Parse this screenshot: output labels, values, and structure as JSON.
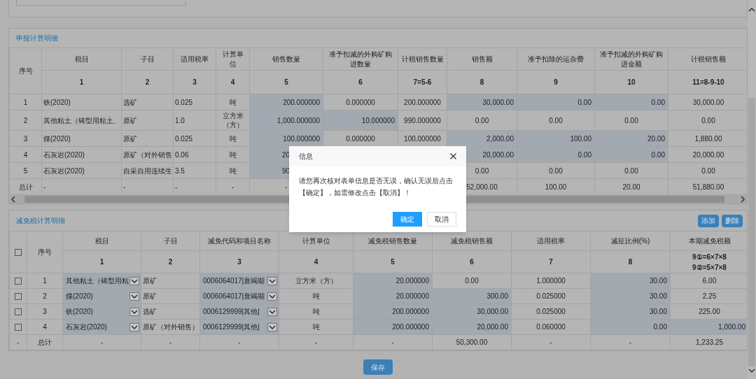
{
  "declaration": {
    "title": "申报计算明细",
    "columns": [
      "序号",
      "税目",
      "子目",
      "适用税率",
      "计算单位",
      "销售数量",
      "准予扣减的外购矿购进数量",
      "计税销售数量",
      "销售额",
      "准予扣除的运杂费",
      "准予扣减的外购矿购进金额",
      "计税销售额"
    ],
    "column_numbers": [
      "1",
      "2",
      "3",
      "4",
      "5",
      "6",
      "7=5-6",
      "8",
      "9",
      "10",
      "11=8-9-10"
    ],
    "rows": [
      {
        "cells": [
          {
            "text": "1",
            "kind": "text"
          },
          {
            "text": "铁(2020)",
            "kind": "text"
          },
          {
            "text": "选矿",
            "kind": "text"
          },
          {
            "text": "0.025",
            "kind": "text"
          },
          {
            "text": "吨",
            "kind": "text"
          },
          {
            "text": "200.000000",
            "kind": "input"
          },
          {
            "text": "0.000000",
            "kind": "text"
          },
          {
            "text": "200.000000",
            "kind": "text"
          },
          {
            "text": "30,000.00",
            "kind": "input"
          },
          {
            "text": "0.00",
            "kind": "input"
          },
          {
            "text": "0.00",
            "kind": "input"
          },
          {
            "text": "30,000.00",
            "kind": "text"
          }
        ]
      },
      {
        "cells": [
          {
            "text": "2",
            "kind": "text"
          },
          {
            "text": "其他粘土（铸型用粘土、",
            "kind": "text"
          },
          {
            "text": "原矿",
            "kind": "text"
          },
          {
            "text": "1.0",
            "kind": "text"
          },
          {
            "text": "立方米（方）",
            "kind": "text"
          },
          {
            "text": "1,000.000000",
            "kind": "input"
          },
          {
            "text": "10.000000",
            "kind": "input"
          },
          {
            "text": "990.000000",
            "kind": "text"
          },
          {
            "text": "0.00",
            "kind": "text"
          },
          {
            "text": "0.00",
            "kind": "text"
          },
          {
            "text": "0.00",
            "kind": "text"
          },
          {
            "text": "0.00",
            "kind": "text"
          }
        ]
      },
      {
        "cells": [
          {
            "text": "3",
            "kind": "text"
          },
          {
            "text": "煤(2020)",
            "kind": "text"
          },
          {
            "text": "原矿",
            "kind": "text"
          },
          {
            "text": "0.025",
            "kind": "text"
          },
          {
            "text": "吨",
            "kind": "text"
          },
          {
            "text": "100.000000",
            "kind": "input"
          },
          {
            "text": "0.000000",
            "kind": "text"
          },
          {
            "text": "100.000000",
            "kind": "text"
          },
          {
            "text": "2,000.00",
            "kind": "input"
          },
          {
            "text": "100.00",
            "kind": "input"
          },
          {
            "text": "20.00",
            "kind": "input"
          },
          {
            "text": "1,880.00",
            "kind": "text"
          }
        ]
      },
      {
        "cells": [
          {
            "text": "4",
            "kind": "text"
          },
          {
            "text": "石灰岩(2020)",
            "kind": "text"
          },
          {
            "text": "原矿（对外销售",
            "kind": "text"
          },
          {
            "text": "0.06",
            "kind": "text"
          },
          {
            "text": "吨",
            "kind": "text"
          },
          {
            "text": "20",
            "kind": "cut-input"
          },
          {},
          {},
          {
            "text": "20,000.00",
            "kind": "input"
          },
          {
            "text": "0.00",
            "kind": "input"
          },
          {
            "text": "0.00",
            "kind": "input"
          },
          {
            "text": "20,000.00",
            "kind": "text"
          }
        ]
      },
      {
        "cells": [
          {
            "text": "5",
            "kind": "text"
          },
          {
            "text": "石灰岩(2020)",
            "kind": "text"
          },
          {
            "text": "自采自用连续生",
            "kind": "text"
          },
          {
            "text": "3.5",
            "kind": "text"
          },
          {
            "text": "吨",
            "kind": "text"
          },
          {
            "text": "90",
            "kind": "cut-input"
          },
          {},
          {},
          {
            "text": "0.00",
            "kind": "text"
          },
          {
            "text": "0.00",
            "kind": "text"
          },
          {
            "text": "0.00",
            "kind": "text"
          },
          {
            "text": "0.00",
            "kind": "text"
          }
        ]
      },
      {
        "cells": [
          {
            "text": "总计",
            "kind": "text"
          },
          {
            "text": "-",
            "kind": "text"
          },
          {
            "text": "-",
            "kind": "text"
          },
          {
            "text": "-",
            "kind": "text"
          },
          {
            "text": "-",
            "kind": "text"
          },
          {
            "text": "-",
            "kind": "text"
          },
          {},
          {},
          {
            "text": "52,000.00",
            "kind": "text"
          },
          {
            "text": "100.00",
            "kind": "text"
          },
          {
            "text": "20.00",
            "kind": "text"
          },
          {
            "text": "51,880.00",
            "kind": "text"
          }
        ]
      }
    ]
  },
  "relief": {
    "title": "减免税计算明细",
    "buttons": [
      "添加",
      "删除"
    ],
    "columns": [
      "序号",
      "税目",
      "子目",
      "减免代码和项目名称",
      "计算单位",
      "减免税销售数量",
      "减免税销售额",
      "适用税率",
      "减征比例(%)",
      "本期减免税额"
    ],
    "column_numbers": [
      "1",
      "2",
      "3",
      "4",
      "5",
      "6",
      "7",
      "8",
      "9①=6×7×8\n9②=5×7×8"
    ],
    "rows": [
      {
        "checked": false,
        "cells": [
          {
            "text": "1",
            "kind": "text"
          },
          {
            "text": "其他粘土（铸型用粘",
            "kind": "select"
          },
          {
            "text": "原矿",
            "kind": "text"
          },
          {
            "text": "0006064017|衰竭期",
            "kind": "select"
          },
          {
            "text": "立方米（方）",
            "kind": "text"
          },
          {
            "text": "20.000000",
            "kind": "input"
          },
          {
            "text": "0.00",
            "kind": "text"
          },
          {
            "text": "1.000000",
            "kind": "text"
          },
          {
            "text": "30.00",
            "kind": "input"
          },
          {
            "text": "6.00",
            "kind": "text"
          }
        ]
      },
      {
        "checked": false,
        "cells": [
          {
            "text": "2",
            "kind": "text"
          },
          {
            "text": "煤(2020)",
            "kind": "select"
          },
          {
            "text": "原矿",
            "kind": "text"
          },
          {
            "text": "0006064017|衰竭期",
            "kind": "select"
          },
          {
            "text": "吨",
            "kind": "text"
          },
          {
            "text": "20.000000",
            "kind": "input"
          },
          {
            "text": "300.00",
            "kind": "input"
          },
          {
            "text": "0.025000",
            "kind": "text"
          },
          {
            "text": "30.00",
            "kind": "input"
          },
          {
            "text": "2.25",
            "kind": "text"
          }
        ]
      },
      {
        "checked": false,
        "cells": [
          {
            "text": "3",
            "kind": "text"
          },
          {
            "text": "铁(2020)",
            "kind": "select"
          },
          {
            "text": "选矿",
            "kind": "text"
          },
          {
            "text": "0006129999|其他|",
            "kind": "select"
          },
          {
            "text": "吨",
            "kind": "text"
          },
          {
            "text": "200.000000",
            "kind": "input"
          },
          {
            "text": "30,000.00",
            "kind": "input"
          },
          {
            "text": "0.025000",
            "kind": "text"
          },
          {
            "text": "30.00",
            "kind": "input"
          },
          {
            "text": "225.00",
            "kind": "text"
          }
        ]
      },
      {
        "checked": false,
        "cells": [
          {
            "text": "4",
            "kind": "text"
          },
          {
            "text": "石灰岩(2020)",
            "kind": "select"
          },
          {
            "text": "原矿（对外销售）",
            "kind": "text"
          },
          {
            "text": "0006129999|其他|",
            "kind": "select"
          },
          {
            "text": "吨",
            "kind": "text"
          },
          {
            "text": "200.000000",
            "kind": "input"
          },
          {
            "text": "20,000.00",
            "kind": "input"
          },
          {
            "text": "0.060000",
            "kind": "text"
          },
          {
            "text": "0.00",
            "kind": "input"
          },
          {
            "text": "1,000.00",
            "kind": "input"
          }
        ]
      }
    ],
    "total_row": [
      "-",
      "总计",
      "-",
      "-",
      "-",
      "-",
      "-",
      "50,300.00",
      "-",
      "-",
      "1,233.25"
    ]
  },
  "save_button": "保存",
  "dialog": {
    "title": "信息",
    "message": "请您再次核对表单信息是否无误，确认无误后点击【确定】，如需修改点击【取消】！",
    "buttons": [
      {
        "label": "确定",
        "primary": true
      },
      {
        "label": "取消",
        "primary": false
      }
    ]
  }
}
